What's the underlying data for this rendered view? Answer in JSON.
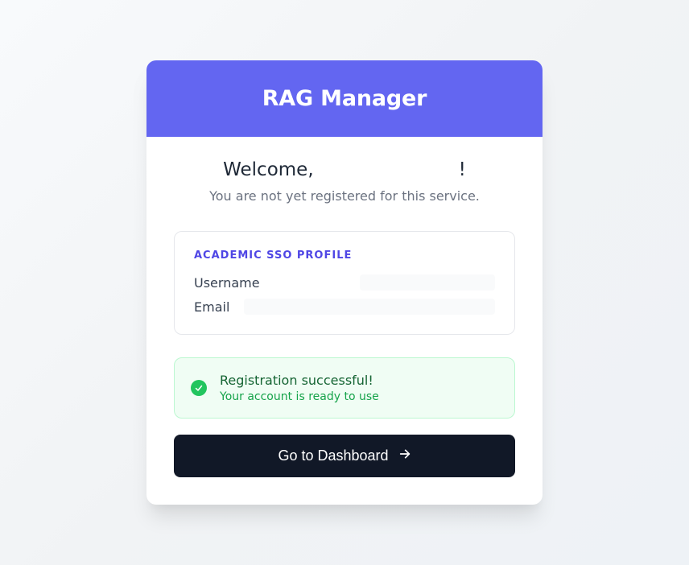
{
  "header": {
    "title": "RAG Manager"
  },
  "welcome": {
    "prefix": "Welcome,",
    "suffix": "!",
    "subtext": "You are not yet registered for this service."
  },
  "profile": {
    "section_title": "Academic SSO Profile",
    "username_label": "Username",
    "email_label": "Email"
  },
  "alert": {
    "title": "Registration successful!",
    "subtext": "Your account is ready to use"
  },
  "cta": {
    "label": "Go to Dashboard"
  }
}
